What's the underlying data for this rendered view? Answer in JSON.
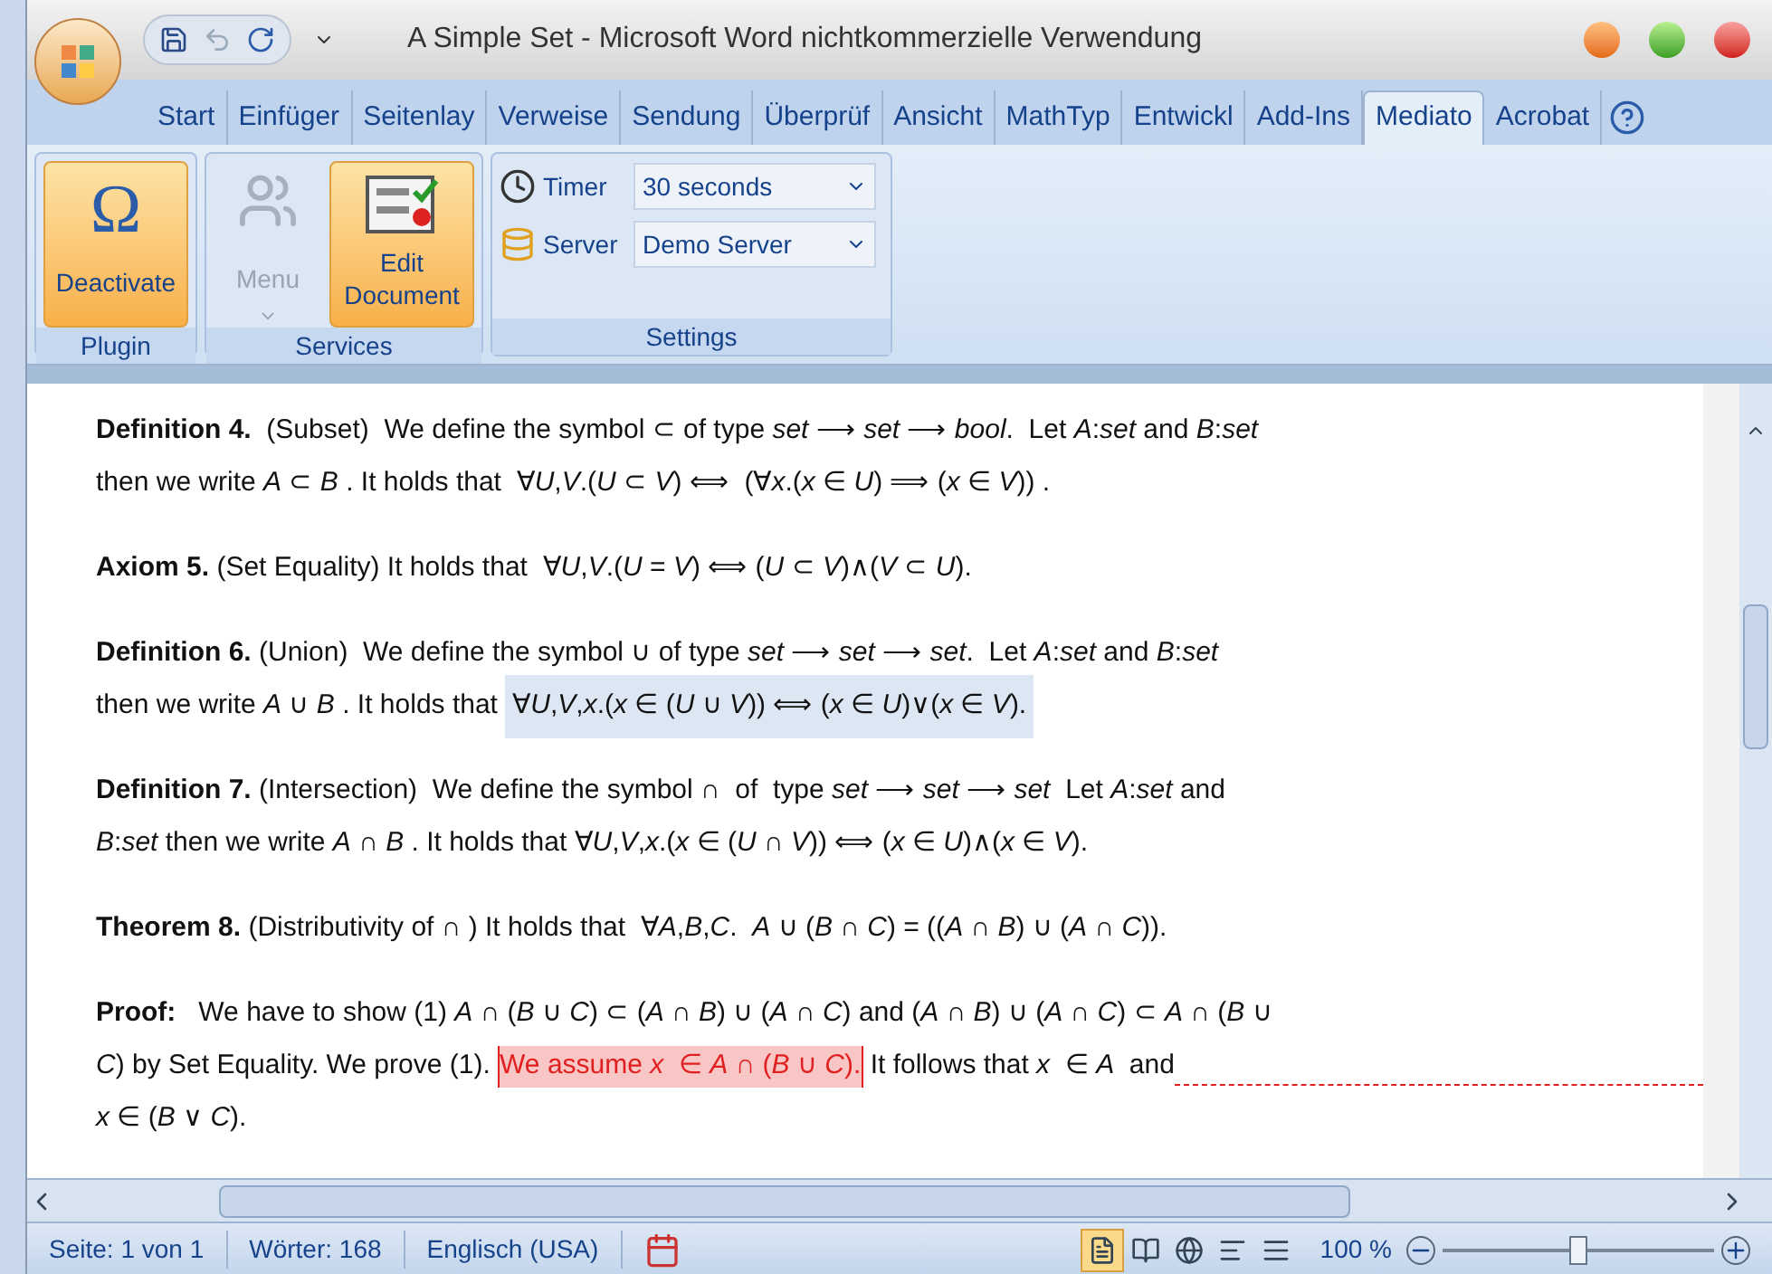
{
  "window": {
    "title": "A Simple Set - Microsoft Word nichtkommerzielle Verwendung"
  },
  "tabs": [
    {
      "label": "Start",
      "selected": false
    },
    {
      "label": "Einfüger",
      "selected": false
    },
    {
      "label": "Seitenlay",
      "selected": false
    },
    {
      "label": "Verweise",
      "selected": false
    },
    {
      "label": "Sendung",
      "selected": false
    },
    {
      "label": "Überprüf",
      "selected": false
    },
    {
      "label": "Ansicht",
      "selected": false
    },
    {
      "label": "MathTyp",
      "selected": false
    },
    {
      "label": "Entwickl",
      "selected": false
    },
    {
      "label": "Add-Ins",
      "selected": false
    },
    {
      "label": "Mediato",
      "selected": true
    },
    {
      "label": "Acrobat",
      "selected": false
    }
  ],
  "ribbon": {
    "groups": [
      {
        "label": "Plugin",
        "controls": [
          {
            "kind": "button",
            "icon": "Ω",
            "label": "Deactivate",
            "active": true,
            "disabled": false
          }
        ]
      },
      {
        "label": "Services",
        "controls": [
          {
            "kind": "menu",
            "label": "Menu",
            "active": false,
            "disabled": true
          },
          {
            "kind": "edit",
            "label": "Edit Document",
            "active": true,
            "disabled": false
          }
        ]
      },
      {
        "label": "Settings",
        "controls": [
          {
            "kind": "timer",
            "label": "Timer",
            "value": "30 seconds"
          },
          {
            "kind": "server",
            "label": "Server",
            "value": "Demo Server"
          }
        ]
      }
    ]
  },
  "document": {
    "paragraphs": [
      {
        "lines": [
          [
            {
              "kind": "text",
              "text": "**Definition 4.**  (Subset)  We define the symbol ⊂ of type *set* ⟶ *set* ⟶ *bool*.  Let *A*:*set* and *B*:*set*"
            }
          ],
          [
            {
              "kind": "text",
              "text": "then we write *A* ⊂ *B* . It holds that  ∀*U*,*V*.(*U* ⊂ *V*) ⟺  (∀*x*.(*x* ∈ *U*) ⟹ (*x* ∈ *V*)) ."
            }
          ]
        ]
      },
      {
        "lines": [
          [
            {
              "kind": "text",
              "text": "**Axiom 5.** (Set Equality) It holds that  ∀*U*,*V*.(*U* = *V*) ⟺ (*U* ⊂ *V*)∧(*V* ⊂ *U*)."
            }
          ]
        ]
      },
      {
        "lines": [
          [
            {
              "kind": "text",
              "text": "**Definition 6.** (Union)  We define the symbol ∪ of type *set* ⟶ *set* ⟶ *set*.  Let *A*:*set* and *B*:*set*"
            }
          ],
          [
            {
              "kind": "text",
              "text": "then we write *A* ∪ *B* . It holds that "
            },
            {
              "kind": "shaded",
              "text": "∀*U*,*V*,*x*.(*x* ∈ (*U* ∪ *V*)) ⟺ (*x* ∈ *U*)∨(*x* ∈ *V*)."
            }
          ]
        ]
      },
      {
        "lines": [
          [
            {
              "kind": "text",
              "text": "**Definition 7.** (Intersection)  We define the symbol ∩  of  type *set* ⟶ *set* ⟶ *set*  Let *A*:*set* and"
            }
          ],
          [
            {
              "kind": "text",
              "text": "*B*:*set* then we write *A* ∩ *B* . It holds that ∀*U*,*V*,*x*.(*x* ∈ (*U* ∩ *V*)) ⟺ (*x* ∈ *U*)∧(*x* ∈ *V*)."
            }
          ]
        ]
      },
      {
        "lines": [
          [
            {
              "kind": "text",
              "text": "**Theorem 8.** (Distributivity of ∩ ) It holds that  ∀*A*,*B*,*C*.  *A* ∪ (*B* ∩ *C*) = ((*A* ∩ *B*) ∪ (*A* ∩ *C*))."
            }
          ]
        ]
      },
      {
        "lines": [
          [
            {
              "kind": "text",
              "text": "**Proof:**   We have to show (1) *A* ∩ (*B* ∪ *C*) ⊂ (*A* ∩ *B*) ∪ (*A* ∩ *C*) and (*A* ∩ *B*) ∪ (*A* ∩ *C*) ⊂ *A* ∩ (*B* ∪"
            }
          ],
          [
            {
              "kind": "text",
              "text": "*C*) by Set Equality. We prove (1). "
            },
            {
              "kind": "comment",
              "text": "We assume *x*  ∈ *A* ∩ (*B* ∪ *C*)."
            },
            {
              "kind": "text",
              "text": " It follows that *x*  ∈ *A*  and"
            }
          ],
          [
            {
              "kind": "text",
              "text": "*x* ∈ (*B* ∨ *C*)."
            }
          ]
        ]
      }
    ]
  },
  "status_bar": {
    "page": "Seite: 1 von 1",
    "words": "Wörter: 168",
    "language": "Englisch (USA)",
    "views": [
      {
        "selected": true
      },
      {
        "selected": false
      },
      {
        "selected": false
      },
      {
        "selected": false
      },
      {
        "selected": false
      }
    ],
    "zoom": "100 %",
    "zoom_slider": {
      "level": 0.5
    }
  }
}
